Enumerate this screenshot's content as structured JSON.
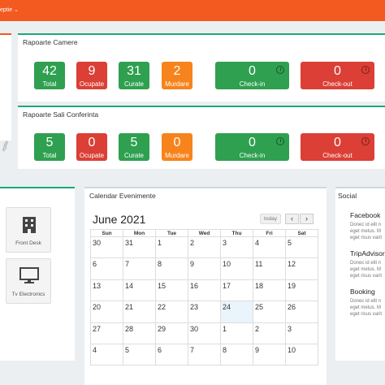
{
  "topbar": {
    "menu_label": "eptie ⌄"
  },
  "rooms": {
    "title": "Rapoarte Camere",
    "stats": [
      {
        "value": "42",
        "label": "Total"
      },
      {
        "value": "9",
        "label": "Ocupate"
      },
      {
        "value": "31",
        "label": "Curate"
      },
      {
        "value": "2",
        "label": "Murdare"
      }
    ],
    "checkin": {
      "value": "0",
      "label": "Check-in"
    },
    "checkout": {
      "value": "0",
      "label": "Check-out"
    }
  },
  "conference": {
    "title": "Rapoarte Sali Conferinta",
    "stats": [
      {
        "value": "5",
        "label": "Total"
      },
      {
        "value": "0",
        "label": "Ocupate"
      },
      {
        "value": "5",
        "label": "Curate"
      },
      {
        "value": "0",
        "label": "Murdare"
      }
    ],
    "checkin": {
      "value": "0",
      "label": "Check-in"
    },
    "checkout": {
      "value": "0",
      "label": "Check-out"
    }
  },
  "left_fragment": {
    "text": "eptie"
  },
  "devices": [
    {
      "label": "Front Desk",
      "icon": "building-icon"
    },
    {
      "label": "Tv Electronics",
      "icon": "monitor-icon"
    }
  ],
  "calendar": {
    "title": "Calendar Evenimente",
    "month": "June 2021",
    "today_label": "today",
    "prev_label": "‹",
    "next_label": "›",
    "weekdays": [
      "Sun",
      "Mon",
      "Tue",
      "Wed",
      "Thu",
      "Fri",
      "Sat"
    ],
    "weeks": [
      [
        "30",
        "31",
        "1",
        "2",
        "3",
        "4",
        "5"
      ],
      [
        "6",
        "7",
        "8",
        "9",
        "10",
        "11",
        "12"
      ],
      [
        "13",
        "14",
        "15",
        "16",
        "17",
        "18",
        "19"
      ],
      [
        "20",
        "21",
        "22",
        "23",
        "24",
        "25",
        "26"
      ],
      [
        "27",
        "28",
        "29",
        "30",
        "1",
        "2",
        "3"
      ],
      [
        "4",
        "5",
        "6",
        "7",
        "8",
        "9",
        "10"
      ]
    ]
  },
  "social": {
    "title": "Social",
    "items": [
      {
        "name": "Facebook",
        "l1": "Donec id elit n",
        "l2": "eget metus. M",
        "l3": "eget risus varit"
      },
      {
        "name": "TripAdvisor",
        "l1": "Donec id elit n",
        "l2": "eget metus. M",
        "l3": "eget risus varit"
      },
      {
        "name": "Booking",
        "l1": "Donec id elit n",
        "l2": "eget metus. M",
        "l3": "eget risus varit"
      }
    ]
  },
  "colors": {
    "orange": "#f35a1f",
    "green": "#2ea04f",
    "red": "#db3f35",
    "amber": "#f7831c",
    "teal": "#1ba97a"
  }
}
